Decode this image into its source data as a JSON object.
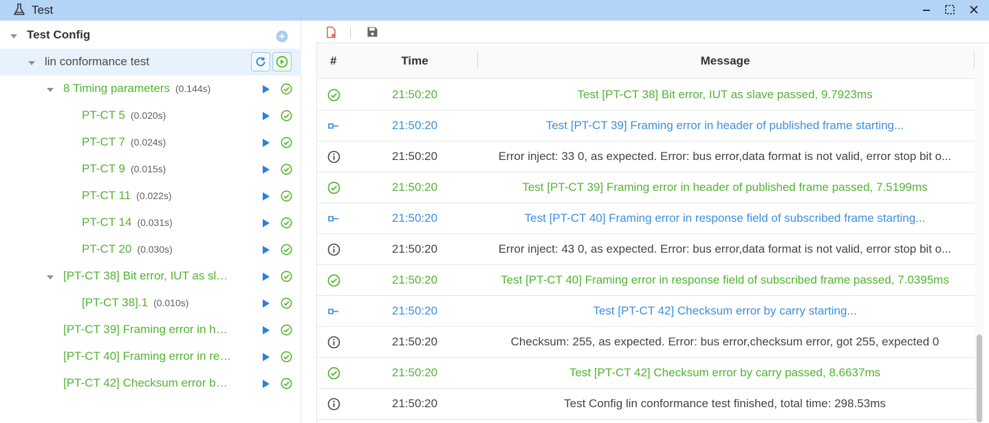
{
  "window": {
    "title": "Test"
  },
  "tree": {
    "root": {
      "label": "Test Config"
    },
    "config": {
      "label": "lin conformance test"
    },
    "items": [
      {
        "label": "8 Timing parameters",
        "duration": "(0.144s)",
        "level": 1,
        "expanded": true
      },
      {
        "label": "PT-CT 5",
        "duration": "(0.020s)",
        "level": 2
      },
      {
        "label": "PT-CT 7",
        "duration": "(0.024s)",
        "level": 2
      },
      {
        "label": "PT-CT 9",
        "duration": "(0.015s)",
        "level": 2
      },
      {
        "label": "PT-CT 11",
        "duration": "(0.022s)",
        "level": 2
      },
      {
        "label": "PT-CT 14",
        "duration": "(0.031s)",
        "level": 2
      },
      {
        "label": "PT-CT 20",
        "duration": "(0.030s)",
        "level": 2
      },
      {
        "label": "[PT-CT 38] Bit error, IUT as sl…",
        "duration": "",
        "level": 1,
        "expanded": true
      },
      {
        "label": "[PT-CT 38].1",
        "duration": "(0.010s)",
        "level": 2
      },
      {
        "label": "[PT-CT 39] Framing error in h…",
        "duration": "",
        "level": 1
      },
      {
        "label": "[PT-CT 40] Framing error in re…",
        "duration": "",
        "level": 1
      },
      {
        "label": "[PT-CT 42] Checksum error b…",
        "duration": "",
        "level": 1
      }
    ]
  },
  "log": {
    "columns": {
      "index": "#",
      "time": "Time",
      "message": "Message"
    },
    "rows": [
      {
        "kind": "pass",
        "time": "21:50:20",
        "message": "Test [PT-CT 38] Bit error, IUT as slave passed, 9.7923ms"
      },
      {
        "kind": "start",
        "time": "21:50:20",
        "message": "Test [PT-CT 39] Framing error in header of published frame starting..."
      },
      {
        "kind": "info",
        "time": "21:50:20",
        "message": "Error inject: 33 0, as expected. Error: bus error,data format is not valid, error stop bit o..."
      },
      {
        "kind": "pass",
        "time": "21:50:20",
        "message": "Test [PT-CT 39] Framing error in header of published frame passed, 7.5199ms"
      },
      {
        "kind": "start",
        "time": "21:50:20",
        "message": "Test [PT-CT 40] Framing error in response field of subscribed frame starting..."
      },
      {
        "kind": "info",
        "time": "21:50:20",
        "message": "Error inject: 43 0, as expected. Error: bus error,data format is not valid, error stop bit o..."
      },
      {
        "kind": "pass",
        "time": "21:50:20",
        "message": "Test [PT-CT 40] Framing error in response field of subscribed frame passed, 7.0395ms"
      },
      {
        "kind": "start",
        "time": "21:50:20",
        "message": "Test [PT-CT 42] Checksum error by carry starting..."
      },
      {
        "kind": "info",
        "time": "21:50:20",
        "message": "Checksum: 255, as expected. Error: bus error,checksum error, got 255, expected 0"
      },
      {
        "kind": "pass",
        "time": "21:50:20",
        "message": "Test [PT-CT 42] Checksum error by carry passed, 8.6637ms"
      },
      {
        "kind": "info",
        "time": "21:50:20",
        "message": "Test Config lin conformance test finished, total time: 298.53ms"
      }
    ]
  },
  "colors": {
    "pass": "#52b332",
    "start": "#3b8fe0",
    "info": "#444444",
    "accent": "#2a7fe0",
    "titlebar": "#b3d4f7"
  }
}
